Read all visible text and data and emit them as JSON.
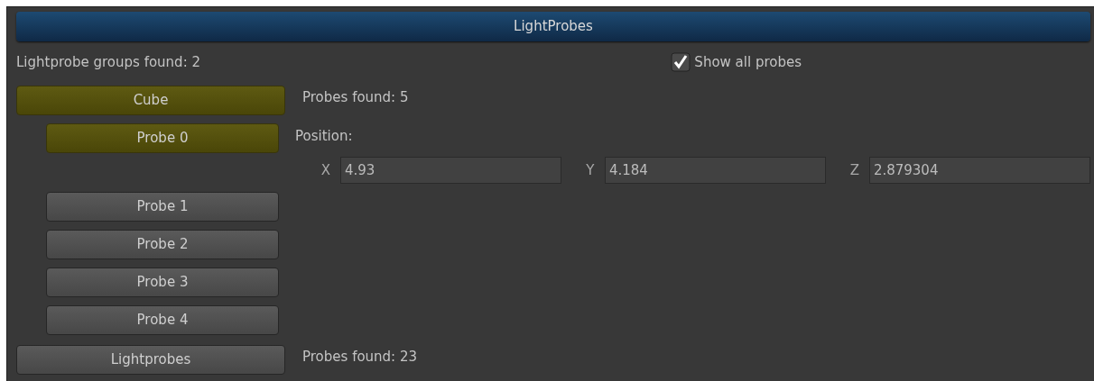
{
  "panel": {
    "title": "LightProbes"
  },
  "summary": "Lightprobe groups found: 2",
  "show_all_probes": {
    "label": "Show all probes",
    "checked": true
  },
  "groups": [
    {
      "label": "Cube",
      "selected": true,
      "probes_found": "Probes found: 5",
      "probes": [
        {
          "label": "Probe 0",
          "selected": true,
          "position": {
            "label": "Position:",
            "axes": [
              {
                "label": "X",
                "value": "4.93"
              },
              {
                "label": "Y",
                "value": "4.184"
              },
              {
                "label": "Z",
                "value": "2.879304"
              }
            ]
          }
        },
        {
          "label": "Probe 1",
          "selected": false
        },
        {
          "label": "Probe 2",
          "selected": false
        },
        {
          "label": "Probe 3",
          "selected": false
        },
        {
          "label": "Probe 4",
          "selected": false
        }
      ]
    },
    {
      "label": "Lightprobes",
      "selected": false,
      "probes_found": "Probes found: 23"
    }
  ]
}
